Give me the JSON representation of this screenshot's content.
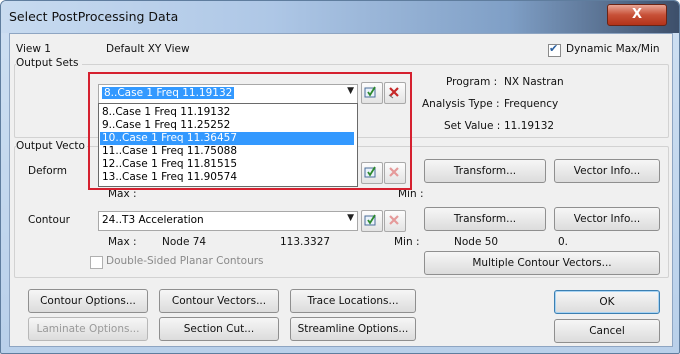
{
  "window": {
    "title": "Select PostProcessing Data",
    "close_label": "X"
  },
  "view": {
    "label": "View 1",
    "name": "Default XY View",
    "dynamic_label": "Dynamic Max/Min",
    "dynamic_checked": true
  },
  "output_sets": {
    "label": "Output Sets",
    "selected": "8..Case 1 Freq 11.19132",
    "options": [
      "8..Case 1 Freq 11.19132",
      "9..Case 1 Freq 11.25252",
      "10..Case 1 Freq 11.36457",
      "11..Case 1 Freq 11.75088",
      "12..Case 1 Freq 11.81515",
      "13..Case 1 Freq 11.90574"
    ],
    "highlighted_index": 2
  },
  "info": {
    "program_label": "Program :",
    "program_value": "NX Nastran",
    "analysis_label": "Analysis Type :",
    "analysis_value": "Frequency",
    "setvalue_label": "Set Value :",
    "setvalue_value": "11.19132"
  },
  "output_vectors": {
    "label": "Output Vecto",
    "deform_label": "Deform",
    "deform_max_label": "Max :",
    "deform_min_label": "Min :",
    "contour_label": "Contour",
    "contour_value": "24..T3 Acceleration",
    "contour_max_label": "Max :",
    "contour_max_node": "Node  74",
    "contour_max_value": "113.3327",
    "contour_min_label": "Min :",
    "contour_min_node": "Node  50",
    "contour_min_value": "0.",
    "double_sided_label": "Double-Sided Planar Contours"
  },
  "buttons": {
    "transform": "Transform...",
    "vector_info": "Vector Info...",
    "multiple_contour_vectors": "Multiple Contour Vectors...",
    "contour_options": "Contour Options...",
    "contour_vectors": "Contour Vectors...",
    "trace_locations": "Trace Locations...",
    "laminate_options": "Laminate Options...",
    "section_cut": "Section Cut...",
    "streamline_options": "Streamline Options...",
    "ok": "OK",
    "cancel": "Cancel"
  },
  "colors": {
    "highlight": "#3399ff",
    "annotation_box": "#d5202f",
    "close_button": "#c75037"
  },
  "icons": [
    "select-icon",
    "delete-icon",
    "dropdown-arrow-icon",
    "checkbox-icon"
  ]
}
